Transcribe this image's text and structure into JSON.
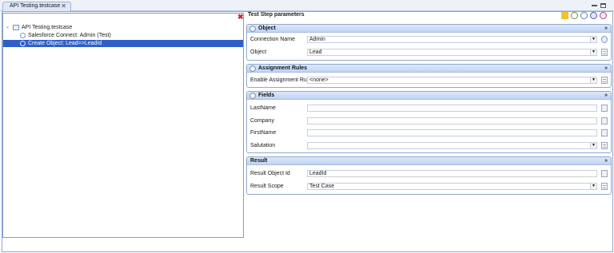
{
  "tab": {
    "title": "API Testing.testcase",
    "close": "✕"
  },
  "tree": {
    "root": "API Testing.testcase",
    "items": [
      {
        "label": "Salesforce Connect: Admin (Test)"
      },
      {
        "label": "Create Object: Lead=>LeadId"
      }
    ]
  },
  "params_title": "Test Step parameters",
  "sections": {
    "object": {
      "title": "Object",
      "rows": [
        {
          "label": "Connection Name",
          "value": "Admin"
        },
        {
          "label": "Object",
          "value": "Lead"
        }
      ]
    },
    "assignment": {
      "title": "Assignment Rules",
      "rows": [
        {
          "label": "Enable Assignment Rule",
          "value": "<none>"
        }
      ]
    },
    "fields": {
      "title": "Fields",
      "rows": [
        {
          "label": "LastName",
          "value": ""
        },
        {
          "label": "Company",
          "value": ""
        },
        {
          "label": "FirstName",
          "value": ""
        },
        {
          "label": "Salutation",
          "value": ""
        }
      ]
    },
    "result": {
      "title": "Result",
      "rows": [
        {
          "label": "Result Object Id",
          "value": "LeadId"
        },
        {
          "label": "Result Scope",
          "value": "Test Case"
        }
      ]
    }
  },
  "icons": {
    "delete": "✖",
    "collapse": "»",
    "dropdown": "▼",
    "twisty": "⌄"
  },
  "colors": {
    "selection": "#2f5fc8",
    "section_header": "#c9dbf6",
    "delete": "#d32222"
  }
}
